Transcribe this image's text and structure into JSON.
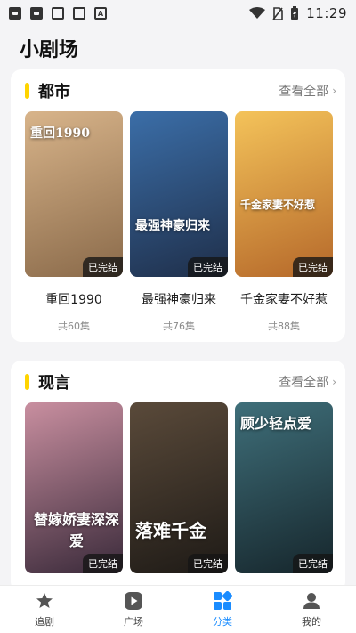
{
  "status_bar": {
    "time": "11:29",
    "icons": [
      "image-icon",
      "image-icon",
      "book-icon",
      "book-icon",
      "text-a-icon",
      "wifi-icon",
      "no-sim-icon",
      "battery-charging-icon"
    ]
  },
  "page": {
    "title": "小剧场"
  },
  "sections": [
    {
      "title": "都市",
      "see_all": "查看全部",
      "cards": [
        {
          "title": "重回1990",
          "count": "共60集",
          "badge": "已完结",
          "poster_text": "重回1990",
          "colors": [
            "#d8b48a",
            "#8a6a4a"
          ]
        },
        {
          "title": "最强神豪归来",
          "count": "共76集",
          "badge": "已完结",
          "poster_text": "最强神豪归来",
          "colors": [
            "#3b6ea8",
            "#1f2f4a"
          ]
        },
        {
          "title": "千金家妻不好惹",
          "count": "共88集",
          "badge": "已完结",
          "poster_text": "千金家妻不好惹",
          "colors": [
            "#f4c35a",
            "#b5682a"
          ]
        }
      ]
    },
    {
      "title": "现言",
      "see_all": "查看全部",
      "cards": [
        {
          "title": "",
          "count": "",
          "badge": "已完结",
          "poster_text": "替嫁娇妻深深爱",
          "colors": [
            "#c98fa0",
            "#3a2a3a"
          ]
        },
        {
          "title": "",
          "count": "",
          "badge": "已完结",
          "poster_text": "落难千金",
          "colors": [
            "#5a4a3a",
            "#1e1a16"
          ]
        },
        {
          "title": "",
          "count": "",
          "badge": "已完结",
          "poster_text": "顾少轻点爱",
          "colors": [
            "#3f6f7a",
            "#16262c"
          ]
        }
      ]
    }
  ],
  "nav": [
    {
      "label": "追剧",
      "icon": "star-icon",
      "active": false
    },
    {
      "label": "广场",
      "icon": "play-icon",
      "active": false
    },
    {
      "label": "分类",
      "icon": "category-icon",
      "active": true
    },
    {
      "label": "我的",
      "icon": "user-icon",
      "active": false
    }
  ],
  "colors": {
    "accent": "#ffd400",
    "active_nav": "#1a8cff",
    "background": "#f4f4f6"
  }
}
